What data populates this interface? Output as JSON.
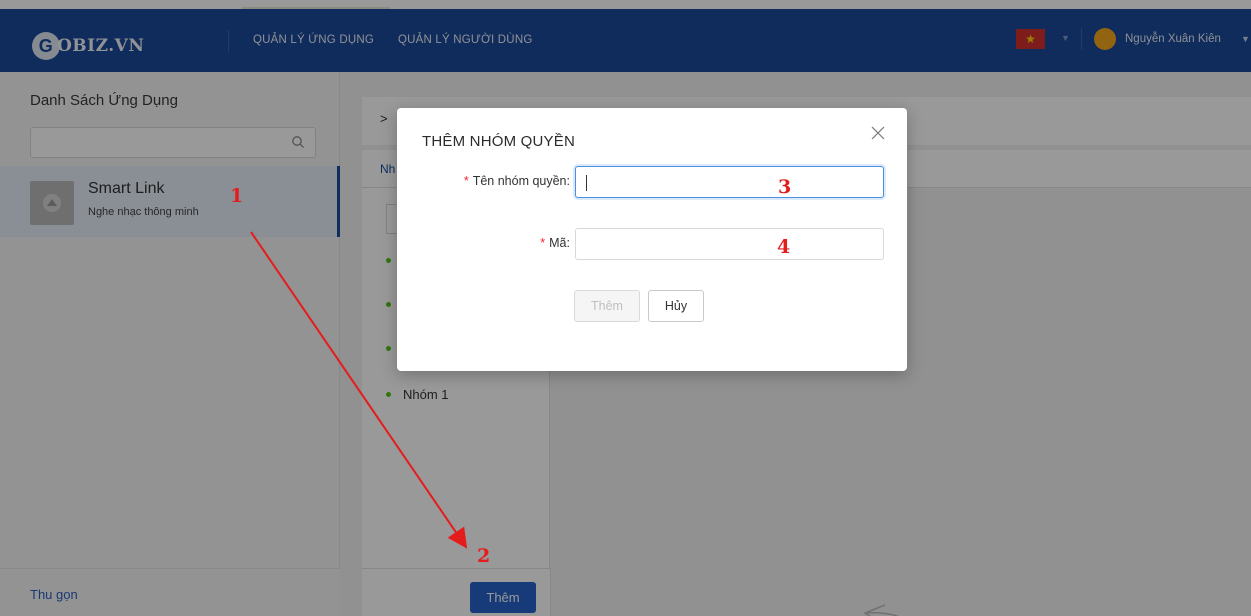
{
  "brand": {
    "logo_mark": "G",
    "logo_text": "OBIZ.VN"
  },
  "nav": {
    "items": [
      "QUẢN LÝ ỨNG DỤNG",
      "QUẢN LÝ NGƯỜI DÙNG"
    ]
  },
  "user": {
    "name": "Nguyễn Xuân Kiên",
    "language_flag": "★"
  },
  "sidebar": {
    "title": "Danh Sách Ứng Dụng",
    "search_placeholder": "",
    "apps": [
      {
        "name": "Smart Link",
        "description": "Nghe nhạc thông minh"
      }
    ],
    "collapse_label": "Thu gọn"
  },
  "main": {
    "breadcrumb_arrow": ">",
    "tab_label": "Nh",
    "groups": [
      "Nhóm 1"
    ],
    "add_button_label": "Thêm"
  },
  "modal": {
    "title": "THÊM NHÓM QUYỀN",
    "fields": [
      {
        "label": "Tên nhóm quyền",
        "value": "",
        "placeholder": ""
      },
      {
        "label": "Mã",
        "value": "",
        "placeholder": ""
      }
    ],
    "submit_label": "Thêm",
    "cancel_label": "Hủy"
  },
  "annotations": [
    "1",
    "2",
    "3",
    "4"
  ],
  "colors": {
    "navbar": "#1a4a9c",
    "primary_button": "#2563c9",
    "required_marker": "#f5222d",
    "annotation": "#e51c1c",
    "group_dot": "#52c41a"
  }
}
